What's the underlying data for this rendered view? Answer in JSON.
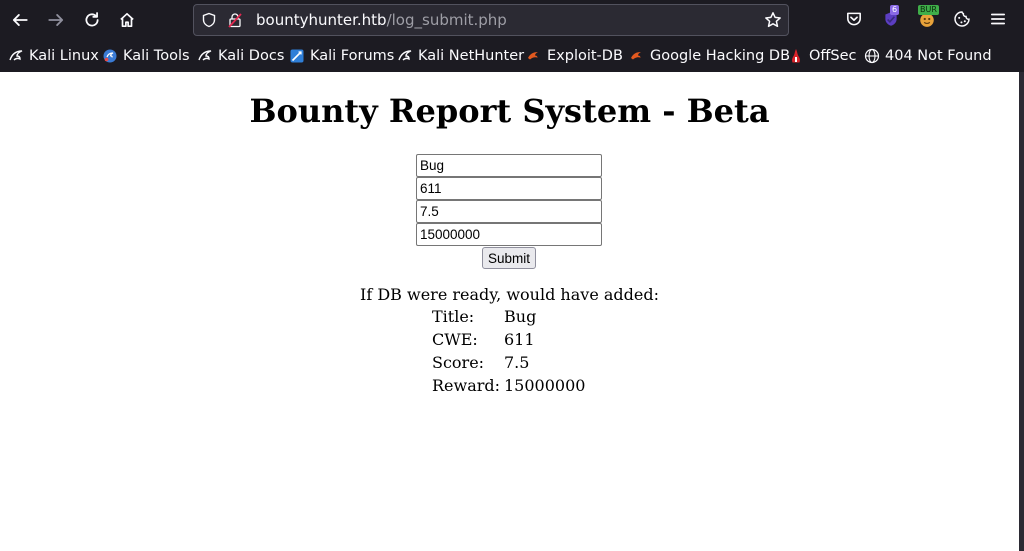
{
  "browser": {
    "url_host": "bountyhunter.htb",
    "url_path": "/log_submit.php",
    "extension_badges": {
      "ublock_count": "6",
      "burp": "BUR"
    },
    "bookmarks": [
      {
        "label": "Kali Linux",
        "icon": "kali-dragon-icon"
      },
      {
        "label": "Kali Tools",
        "icon": "kali-tools-icon"
      },
      {
        "label": "Kali Docs",
        "icon": "kali-dragon-icon"
      },
      {
        "label": "Kali Forums",
        "icon": "kali-forums-icon"
      },
      {
        "label": "Kali NetHunter",
        "icon": "kali-dragon-icon"
      },
      {
        "label": "Exploit-DB",
        "icon": "exploit-db-icon"
      },
      {
        "label": "Google Hacking DB",
        "icon": "exploit-db-icon"
      },
      {
        "label": "OffSec",
        "icon": "offsec-icon"
      },
      {
        "label": "404 Not Found",
        "icon": "globe-icon"
      }
    ]
  },
  "page": {
    "title": "Bounty Report System - Beta",
    "form": {
      "title_value": "Bug",
      "cwe_value": "611",
      "score_value": "7.5",
      "reward_value": "15000000",
      "submit_label": "Submit"
    },
    "result": {
      "message": "If DB were ready, would have added:",
      "rows": [
        {
          "label": "Title:",
          "value": "Bug"
        },
        {
          "label": "CWE:",
          "value": "611"
        },
        {
          "label": "Score:",
          "value": "7.5"
        },
        {
          "label": "Reward:",
          "value": "15000000"
        }
      ]
    }
  },
  "colors": {
    "chrome_bg": "#1c1b22",
    "urlbar_bg": "#2b2a33",
    "text_light": "#fbfbfe"
  }
}
